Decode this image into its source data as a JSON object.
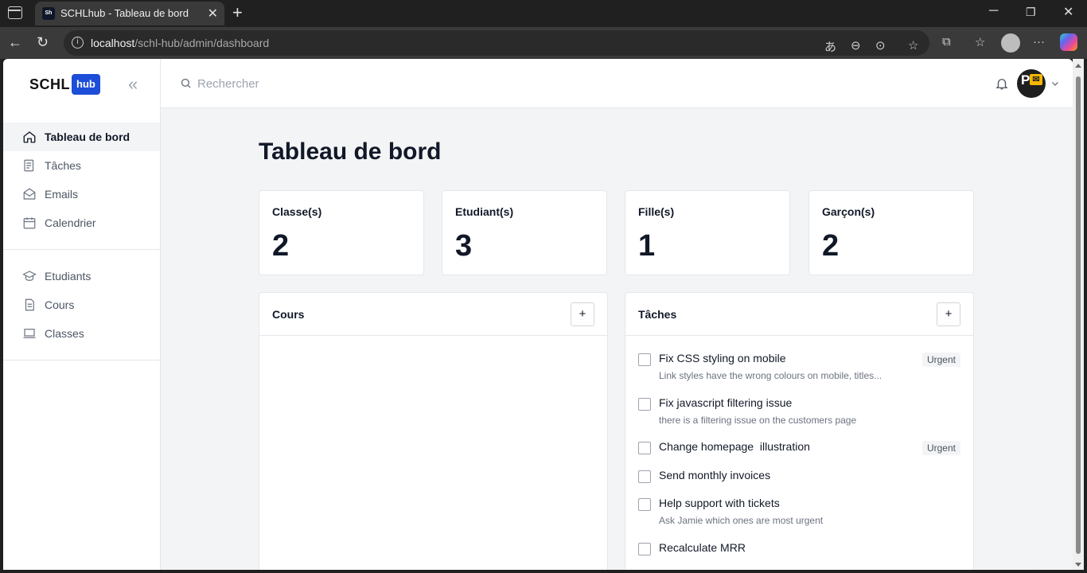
{
  "browser": {
    "tab_title": "SCHLhub - Tableau de bord",
    "favicon_text": "Sh",
    "url_host": "localhost",
    "url_path": "/schl-hub/admin/dashboard"
  },
  "sidebar": {
    "logo_text": "SCHL",
    "logo_badge": "hub",
    "primary_items": [
      {
        "label": "Tableau de bord",
        "icon": "home-icon",
        "active": true
      },
      {
        "label": "Tâches",
        "icon": "tasks-icon"
      },
      {
        "label": "Emails",
        "icon": "mail-icon"
      },
      {
        "label": "Calendrier",
        "icon": "calendar-icon"
      }
    ],
    "secondary_items": [
      {
        "label": "Etudiants",
        "icon": "graduation-cap-icon"
      },
      {
        "label": "Cours",
        "icon": "document-icon"
      },
      {
        "label": "Classes",
        "icon": "laptop-icon"
      }
    ]
  },
  "topbar": {
    "search_placeholder": "Rechercher",
    "avatar_initials": "P"
  },
  "main": {
    "title": "Tableau de bord",
    "stats": [
      {
        "label": "Classe(s)",
        "value": "2"
      },
      {
        "label": "Etudiant(s)",
        "value": "3"
      },
      {
        "label": "Fille(s)",
        "value": "1"
      },
      {
        "label": "Garçon(s)",
        "value": "2"
      }
    ],
    "courses_card": {
      "title": "Cours",
      "add_label": "+"
    },
    "tasks_card": {
      "title": "Tâches",
      "add_label": "+",
      "tasks": [
        {
          "title": "Fix CSS styling on mobile",
          "desc": "Link styles have the wrong colours on mobile, titles...",
          "badge": "Urgent"
        },
        {
          "title": "Fix javascript filtering issue",
          "desc": "there is a filtering issue on the customers page",
          "badge": ""
        },
        {
          "title": "Change homepage  illustration",
          "desc": "",
          "badge": "Urgent"
        },
        {
          "title": "Send monthly invoices",
          "desc": "",
          "badge": ""
        },
        {
          "title": "Help support with tickets",
          "desc": "Ask Jamie which ones are most urgent",
          "badge": ""
        },
        {
          "title": "Recalculate MRR",
          "desc": "",
          "badge": ""
        }
      ]
    },
    "fab_label": "+"
  },
  "colors": {
    "brand": "#1d4ed8",
    "page_bg": "#f3f4f6",
    "text_primary": "#111827"
  }
}
